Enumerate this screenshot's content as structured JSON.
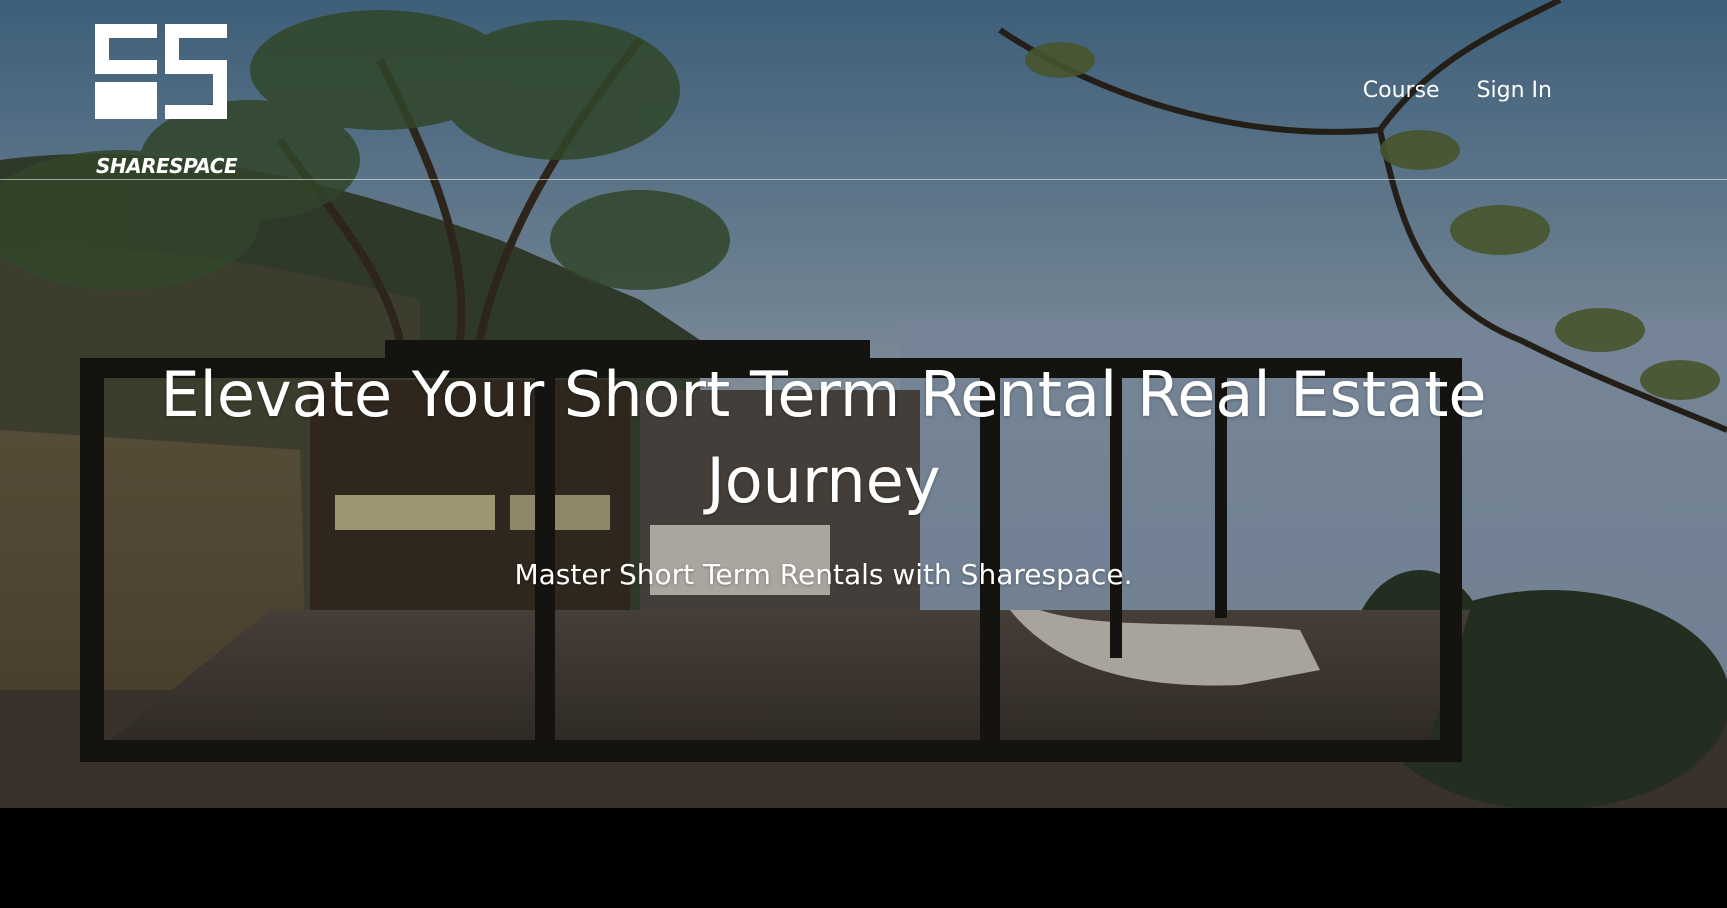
{
  "brand": {
    "name": "SHARESPACE",
    "logo_icon": "sharespace-logo-icon"
  },
  "nav": {
    "items": [
      {
        "label": "Course"
      },
      {
        "label": "Sign In"
      }
    ]
  },
  "hero": {
    "headline": "Elevate Your Short Term Rental Real Estate Journey",
    "subheadline": "Master Short Term Rentals with Sharespace.",
    "background": "modern-glass-cabin-on-cliff-photo"
  },
  "colors": {
    "text": "#ffffff",
    "footer": "#000000"
  }
}
